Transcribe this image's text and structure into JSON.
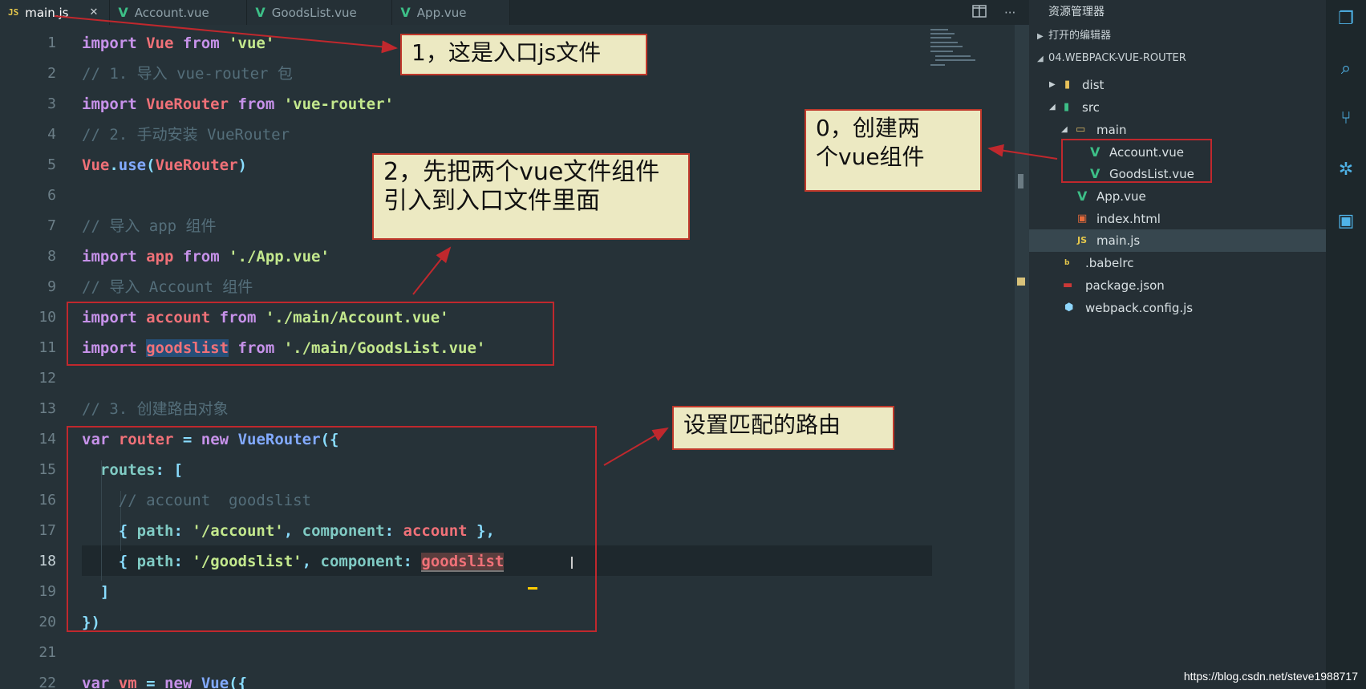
{
  "tabs": [
    {
      "label": "main.js",
      "icon": "js-file-icon",
      "active": true
    },
    {
      "label": "Account.vue",
      "icon": "vue-file-icon"
    },
    {
      "label": "GoodsList.vue",
      "icon": "vue-file-icon"
    },
    {
      "label": "App.vue",
      "icon": "vue-file-icon"
    }
  ],
  "tab_close": "✕",
  "js_badge": "JS",
  "vue_badge": "V",
  "explorer": {
    "title": "资源管理器",
    "open_editors": "打开的编辑器",
    "project": "04.WEBPACK-VUE-ROUTER",
    "items": [
      {
        "label": "dist"
      },
      {
        "label": "src"
      },
      {
        "label": "main"
      },
      {
        "label": "Account.vue"
      },
      {
        "label": "GoodsList.vue"
      },
      {
        "label": "App.vue"
      },
      {
        "label": "index.html"
      },
      {
        "label": "main.js"
      },
      {
        "label": ".babelrc"
      },
      {
        "label": "package.json"
      },
      {
        "label": "webpack.config.js"
      }
    ]
  },
  "code_lines": [
    "1",
    "2",
    "3",
    "4",
    "5",
    "6",
    "7",
    "8",
    "9",
    "10",
    "11",
    "12",
    "13",
    "14",
    "15",
    "16",
    "17",
    "18",
    "19",
    "20",
    "21",
    "22"
  ],
  "code": {
    "l1": [
      "import",
      "Vue",
      "from",
      "'vue'"
    ],
    "l2": "// 1. 导入 vue-router 包",
    "l3": [
      "import",
      "VueRouter",
      "from",
      "'vue-router'"
    ],
    "l4": "// 2. 手动安装 VueRouter",
    "l5": [
      "Vue",
      ".",
      "use",
      "(",
      "VueRouter",
      ")"
    ],
    "l7": "// 导入 app 组件",
    "l8": [
      "import",
      "app",
      "from",
      "'./App.vue'"
    ],
    "l9": "// 导入 Account 组件",
    "l10": [
      "import",
      "account",
      "from",
      "'./main/Account.vue'"
    ],
    "l11": [
      "import",
      "goodslist",
      "from",
      "'./main/GoodsList.vue'"
    ],
    "l13": "// 3. 创建路由对象",
    "l14": [
      "var",
      "router",
      "=",
      "new",
      "VueRouter",
      "({"
    ],
    "l15": [
      "routes",
      ":",
      "["
    ],
    "l16": "// account  goodslist",
    "l17": [
      "{",
      "path",
      ":",
      "'/account'",
      ",",
      "component",
      ":",
      "account",
      "},"
    ],
    "l18": [
      "{",
      "path",
      ":",
      "'/goodslist'",
      ",",
      "component",
      ":",
      "goodslist"
    ],
    "l19": "]",
    "l20": "})",
    "l22": [
      "var",
      "vm",
      "=",
      "new",
      "Vue",
      "({"
    ]
  },
  "annotations": {
    "a1": "1，这是入口js文件",
    "a0_line1": "0，创建两",
    "a0_line2": "个vue组件",
    "a2_line1": "2，先把两个vue文件组件",
    "a2_line2": "引入到入口文件里面",
    "a3": "设置匹配的路由"
  },
  "watermark": "https://blog.csdn.net/steve1988717",
  "colors": {
    "annotation_border": "#c0282d",
    "annotation_bg": "#ece9c2",
    "vue_green": "#3dbf87",
    "js_yellow": "#e6c84c"
  }
}
